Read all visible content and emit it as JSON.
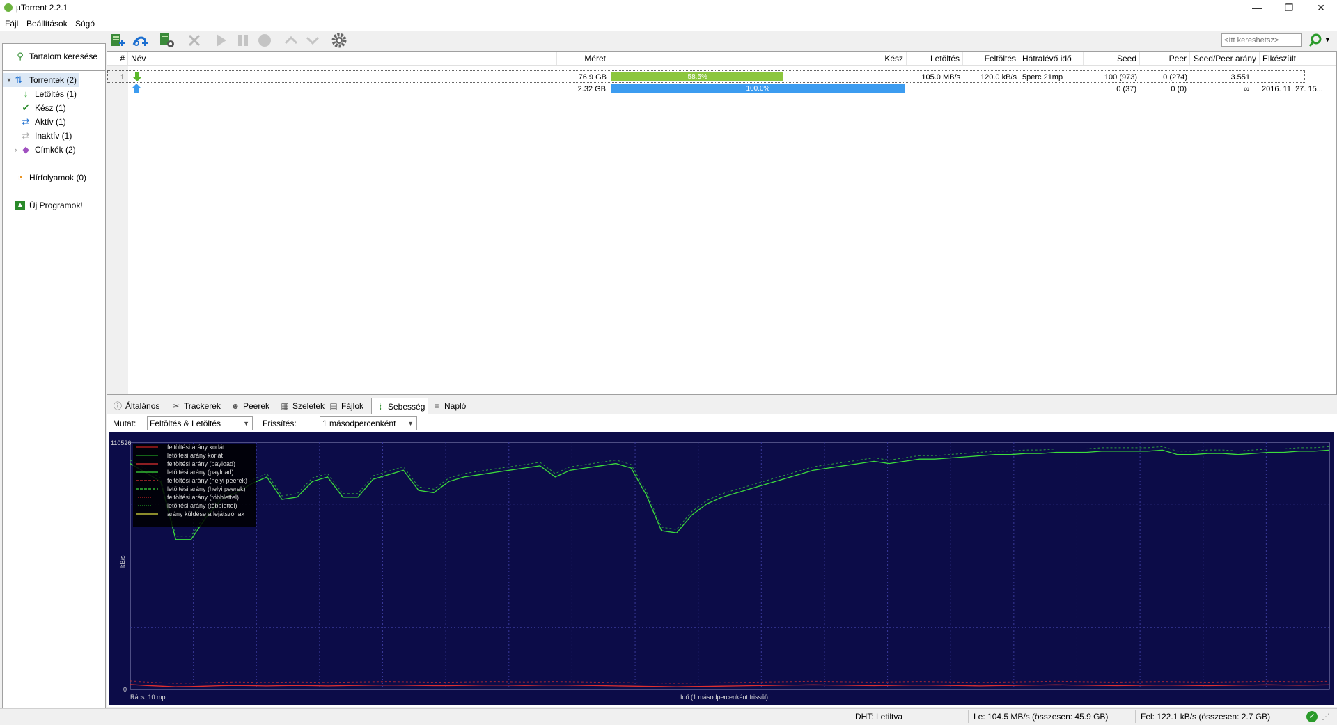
{
  "window": {
    "title": "µTorrent 2.2.1",
    "minimize_glyph": "—",
    "restore_glyph": "❐",
    "close_glyph": "✕"
  },
  "menu": [
    "Fájl",
    "Beállítások",
    "Súgó"
  ],
  "toolbar": {
    "search_placeholder": "<Itt kereshetsz>",
    "icons": [
      "add-torrent-icon",
      "add-url-icon",
      "create-torrent-icon",
      "remove-icon",
      "start-icon",
      "pause-icon",
      "stop-icon",
      "move-up-icon",
      "move-down-icon",
      "preferences-icon"
    ]
  },
  "sidebar": {
    "search": "Tartalom keresése",
    "torrents": "Torrentek (2)",
    "items": [
      "Letöltés (1)",
      "Kész (1)",
      "Aktív (1)",
      "Inaktív (1)",
      "Címkék (2)"
    ],
    "feeds": "Hírfolyamok (0)",
    "apps": "Új Programok!"
  },
  "list": {
    "columns": [
      "#",
      "Név",
      "Méret",
      "Kész",
      "Letöltés",
      "Feltöltés",
      "Hátralévő idő",
      "Seed",
      "Peer",
      "Seed/Peer arány",
      "Elkészült"
    ],
    "rows": [
      {
        "num": "1",
        "status": "downloading",
        "size": "76.9 GB",
        "progress": 0.585,
        "progress_label": "58.5%",
        "progress_color": "#8cc63e",
        "download": "105.0 MB/s",
        "upload": "120.0 kB/s",
        "eta": "5perc 21mp",
        "seeds": "100 (973)",
        "peers": "0 (274)",
        "ratio": "3.551",
        "completed": ""
      },
      {
        "num": "",
        "status": "seeding",
        "size": "2.32 GB",
        "progress": 1.0,
        "progress_label": "100.0%",
        "progress_color": "#3c9cf0",
        "download": "",
        "upload": "",
        "eta": "",
        "seeds": "0 (37)",
        "peers": "0 (0)",
        "ratio": "∞",
        "completed": "2016. 11. 27. 15..."
      }
    ]
  },
  "tabs": [
    "Általános",
    "Trackerek",
    "Peerek",
    "Szeletek",
    "Fájlok",
    "Sebesség",
    "Napló"
  ],
  "active_tab": "Sebesség",
  "speed": {
    "show_label": "Mutat:",
    "show_value": "Feltöltés & Letöltés",
    "refresh_label": "Frissítés:",
    "refresh_value": "1 másodpercenként"
  },
  "chart_data": {
    "type": "line",
    "ylim": [
      0,
      110526
    ],
    "y_top_label": "110526",
    "y_bottom_label": "0",
    "ylabel": "kB/s",
    "xlabel": "Idő (1 másodpercenként frissül)",
    "grid_label": "Rács: 10 mp",
    "legend": [
      {
        "name": "feltöltési arány korlát",
        "color": "#c82020",
        "dash": "solid"
      },
      {
        "name": "letöltési arány korlát",
        "color": "#20a020",
        "dash": "solid"
      },
      {
        "name": "feltöltési arány (payload)",
        "color": "#e03030",
        "dash": "solid"
      },
      {
        "name": "letöltési arány (payload)",
        "color": "#3cdc3c",
        "dash": "solid"
      },
      {
        "name": "feltöltési arány (helyi peerek)",
        "color": "#e03030",
        "dash": "dashed"
      },
      {
        "name": "letöltési arány (helyi peerek)",
        "color": "#3cdc3c",
        "dash": "dashed"
      },
      {
        "name": "feltöltési arány (többlettel)",
        "color": "#c82020",
        "dash": "dotted"
      },
      {
        "name": "letöltési arány (többlettel)",
        "color": "#20a020",
        "dash": "dotted"
      },
      {
        "name": "arány küldése a lejátszónak",
        "color": "#e0e040",
        "dash": "solid"
      }
    ],
    "series": [
      {
        "name": "letöltési arány (payload)",
        "color": "#3cdc3c",
        "values": [
          101000,
          97000,
          93000,
          67000,
          67000,
          77000,
          85000,
          88000,
          92000,
          95000,
          85000,
          86000,
          93000,
          95000,
          86000,
          86000,
          94000,
          96000,
          98000,
          89000,
          88000,
          93000,
          95000,
          96000,
          97000,
          98000,
          99000,
          100000,
          95000,
          98000,
          99000,
          100000,
          101000,
          99000,
          87000,
          71000,
          70000,
          78000,
          83000,
          86000,
          88000,
          90000,
          92000,
          94000,
          96000,
          98000,
          99000,
          100000,
          101000,
          102000,
          101000,
          102000,
          103000,
          103000,
          103500,
          104000,
          104500,
          105000,
          105000,
          105500,
          105500,
          106000,
          106000,
          106000,
          106500,
          106500,
          106500,
          106500,
          107000,
          105000,
          105000,
          105500,
          105500,
          105000,
          105500,
          106000,
          106000,
          106500,
          106500,
          107000
        ]
      },
      {
        "name": "feltöltési arány (payload)",
        "color": "#e03030",
        "values": [
          2200,
          1800,
          1500,
          1200,
          1300,
          1500,
          1700,
          1800,
          1700,
          1600,
          1700,
          1800,
          1700,
          1600,
          1700,
          1800,
          1900,
          2000,
          1900,
          1800,
          1700,
          1700,
          1800,
          1900,
          2000,
          1900,
          1800,
          1900,
          2000,
          1900,
          1800,
          1700,
          1600,
          1500,
          1400,
          1300,
          1200,
          1300,
          1400,
          1500,
          1600,
          1700,
          1800,
          1900,
          2000,
          2100,
          2000,
          1900,
          1800,
          1700,
          1800,
          1900,
          2000,
          1900,
          1800,
          1700,
          1600,
          1700,
          1800,
          1900,
          2000,
          2100,
          2000,
          1900,
          1800,
          1700,
          1800,
          1900,
          2000,
          1900,
          1800,
          1700,
          1800,
          1900,
          2000,
          2100,
          2000,
          1900,
          2000,
          2100
        ]
      }
    ]
  },
  "status": {
    "dht": "DHT: Letiltva",
    "down": "Le: 104.5 MB/s (összesen: 45.9 GB)",
    "up": "Fel: 122.1 kB/s (összesen: 2.7 GB)"
  }
}
